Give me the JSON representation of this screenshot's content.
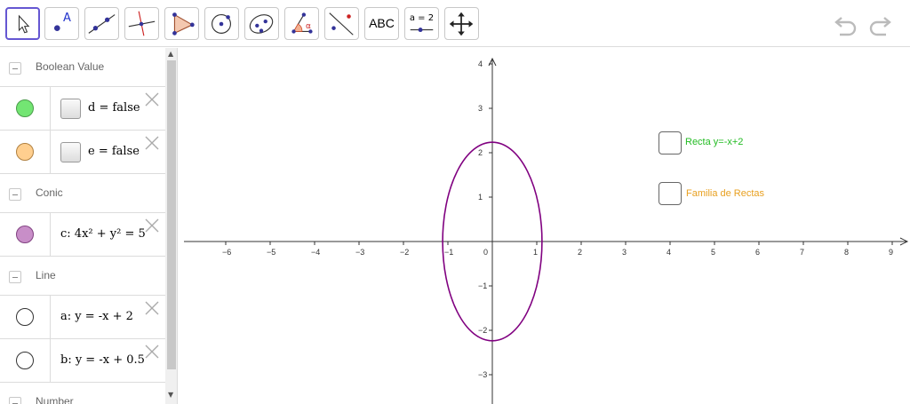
{
  "toolbar": {
    "tools": [
      {
        "name": "move-tool",
        "icon": "pointer-icon"
      },
      {
        "name": "point-tool",
        "icon": "point-icon",
        "label": "A"
      },
      {
        "name": "line-tool",
        "icon": "line-through-points-icon"
      },
      {
        "name": "perpendicular-line-tool",
        "icon": "perpendicular-line-icon"
      },
      {
        "name": "polygon-tool",
        "icon": "polygon-icon"
      },
      {
        "name": "circle-tool",
        "icon": "circle-center-point-icon"
      },
      {
        "name": "ellipse-tool",
        "icon": "ellipse-icon"
      },
      {
        "name": "angle-tool",
        "icon": "angle-icon",
        "label": "α"
      },
      {
        "name": "reflect-tool",
        "icon": "reflect-about-line-icon"
      },
      {
        "name": "text-tool",
        "icon": "text-icon",
        "label": "ABC"
      },
      {
        "name": "slider-tool",
        "icon": "slider-icon",
        "label": "a = 2"
      },
      {
        "name": "move-graphics-tool",
        "icon": "move-graphics-icon"
      }
    ],
    "undo_icon": "undo-icon",
    "redo_icon": "redo-icon"
  },
  "algebra": {
    "groups": {
      "boolean": "Boolean Value",
      "conic": "Conic",
      "line": "Line",
      "number": "Number"
    },
    "items": {
      "d": {
        "expr": "d = false",
        "color": "#73e573"
      },
      "e": {
        "expr": "e = false",
        "color": "#ffcf8f"
      },
      "c": {
        "expr": "c: 4x² + y² = 5",
        "color": "#c88ec8"
      },
      "a": {
        "expr": "a: y = -x + 2",
        "color": "#ffffff"
      },
      "b": {
        "expr": "b: y = -x + 0.5",
        "color": "#ffffff"
      }
    }
  },
  "graphics": {
    "x_ticks": [
      "−6",
      "−5",
      "−4",
      "−3",
      "−2",
      "−1",
      "0",
      "1",
      "2",
      "3",
      "4",
      "5",
      "6",
      "7",
      "8",
      "9"
    ],
    "y_ticks": [
      "4",
      "3",
      "2",
      "1",
      "−1",
      "−2",
      "−3"
    ],
    "checkbox_recta": {
      "label": "Recta y=-x+2",
      "color": "#22bb22"
    },
    "checkbox_familia": {
      "label": "Familia de Rectas",
      "color": "#e8a020"
    },
    "ellipse_color": "#800080"
  },
  "chart_data": {
    "type": "scatter",
    "equation": "4x² + y² = 5",
    "x_range": [
      -7,
      9.3
    ],
    "y_range": [
      -3.5,
      4.5
    ]
  }
}
